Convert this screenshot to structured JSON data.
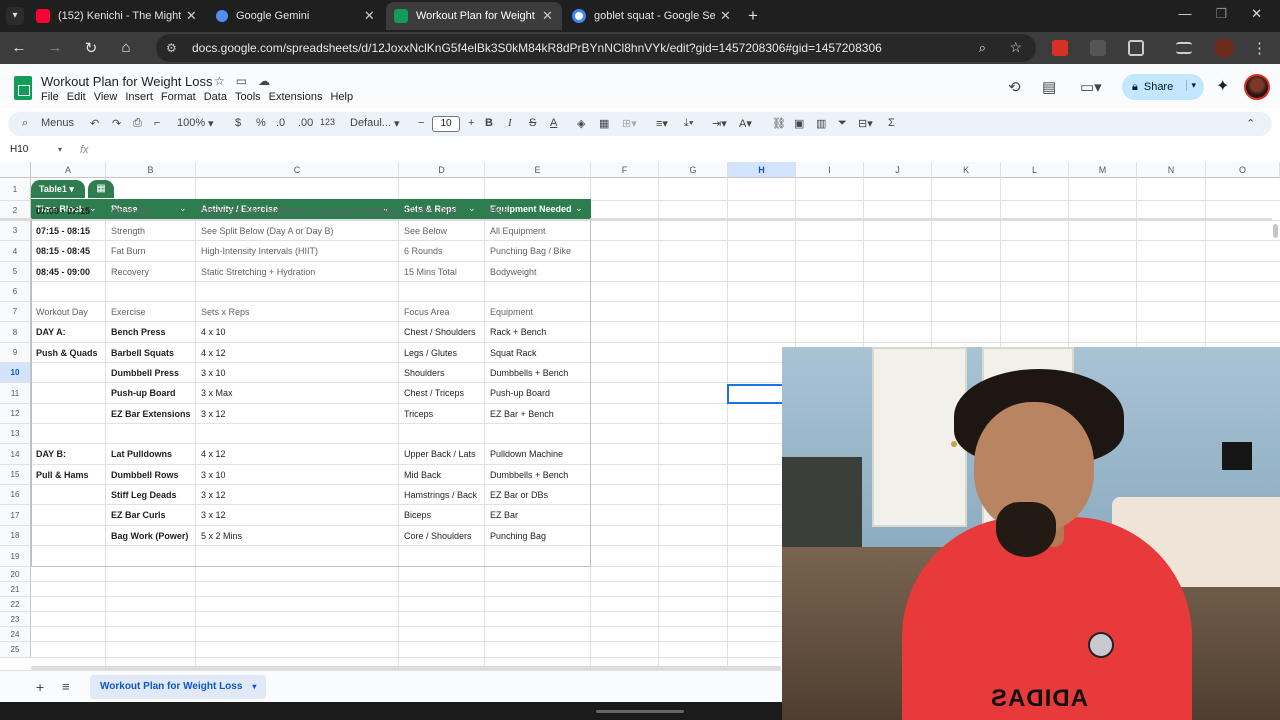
{
  "browser": {
    "tabs": [
      {
        "label": "(152) Kenichi - The Mightiest",
        "color": "#ff0033"
      },
      {
        "label": "Google Gemini",
        "color": "#4f8df9"
      },
      {
        "label": "Workout Plan for Weight Loss",
        "color": "#0f9d58"
      },
      {
        "label": "goblet squat - Google Search",
        "color": "#ffffff"
      }
    ],
    "new_tab": "+",
    "url": "docs.google.com/spreadsheets/d/12JoxxNclKnG5f4elBk3S0kM84kR8dPrBYnNCl8hnVYk/edit?gid=1457208306#gid=1457208306"
  },
  "sheets": {
    "title": "Workout Plan for Weight Loss",
    "menus": [
      "File",
      "Edit",
      "View",
      "Insert",
      "Format",
      "Data",
      "Tools",
      "Extensions",
      "Help"
    ],
    "share_label": "Share",
    "toolbar": {
      "menus_label": "Menus",
      "zoom": "100%",
      "currency": "$",
      "percent": "%",
      "dec_decrease": ".0",
      "dec_increase": ".00",
      "number_format": "123",
      "font": "Defaul...",
      "font_size": "10",
      "bold": "B",
      "italic": "I",
      "strike": "S",
      "text_color": "A",
      "functions": "Σ"
    },
    "name_box": "H10",
    "fx": "fx",
    "columns": [
      "A",
      "B",
      "C",
      "D",
      "E",
      "F",
      "G",
      "H",
      "I",
      "J",
      "K",
      "L",
      "M",
      "N",
      "O"
    ],
    "selected_column": "H",
    "row_numbers": [
      "1",
      "2",
      "3",
      "4",
      "5",
      "6",
      "7",
      "8",
      "9",
      "10",
      "11",
      "12",
      "13",
      "14",
      "15",
      "16",
      "17",
      "18",
      "19",
      "20",
      "21",
      "22",
      "23",
      "24",
      "25"
    ],
    "selected_row": "10",
    "table_name": "Table1",
    "headers": [
      "Time Block",
      "Phase",
      "Activity / Exercise",
      "Sets & Reps",
      "Equipment Needed"
    ],
    "rows": [
      [
        "07:00 - 07:15",
        "Warm-Up",
        "Stationary Bike (Moderate) + Dynamic Stretching",
        "15 Mins Total",
        "Bike"
      ],
      [
        "07:15 - 08:15",
        "Strength",
        "See Split Below (Day A or Day B)",
        "See Below",
        "All Equipment"
      ],
      [
        "08:15 - 08:45",
        "Fat Burn",
        "High-Intensity Intervals (HIIT)",
        "6 Rounds",
        "Punching Bag / Bike"
      ],
      [
        "08:45 - 09:00",
        "Recovery",
        "Static Stretching + Hydration",
        "15 Mins Total",
        "Bodyweight"
      ],
      [
        "",
        "",
        "",
        "",
        ""
      ],
      [
        "Workout Day",
        "Exercise",
        "Sets x Reps",
        "Focus Area",
        "Equipment"
      ],
      [
        "DAY A:",
        "Bench Press",
        "4 x 10",
        "Chest / Shoulders",
        "Rack + Bench"
      ],
      [
        "Push & Quads",
        "Barbell Squats",
        "4 x 12",
        "Legs / Glutes",
        "Squat Rack"
      ],
      [
        "",
        "Dumbbell Press",
        "3 x 10",
        "Shoulders",
        "Dumbbells + Bench"
      ],
      [
        "",
        "Push-up Board",
        "3 x Max",
        "Chest / Triceps",
        "Push-up Board"
      ],
      [
        "",
        "EZ Bar Extensions",
        "3 x 12",
        "Triceps",
        "EZ Bar + Bench"
      ],
      [
        "",
        "",
        "",
        "",
        ""
      ],
      [
        "DAY B:",
        "Lat Pulldowns",
        "4 x 12",
        "Upper Back / Lats",
        "Pulldown Machine"
      ],
      [
        "Pull & Hams",
        "Dumbbell Rows",
        "3 x 10",
        "Mid Back",
        "Dumbbells + Bench"
      ],
      [
        "",
        "Stiff Leg Deads",
        "3 x 12",
        "Hamstrings / Back",
        "EZ Bar or DBs"
      ],
      [
        "",
        "EZ Bar Curls",
        "3 x 12",
        "Biceps",
        "EZ Bar"
      ],
      [
        "",
        "Bag Work (Power)",
        "5 x 2 Mins",
        "Core / Shoulders",
        "Punching Bag"
      ]
    ],
    "sheet_tab": "Workout Plan for Weight Loss",
    "table_color": "#2e7d4f",
    "accent": "#0b57d0"
  },
  "webcam": {
    "shirt_text": "ADIDAS"
  }
}
